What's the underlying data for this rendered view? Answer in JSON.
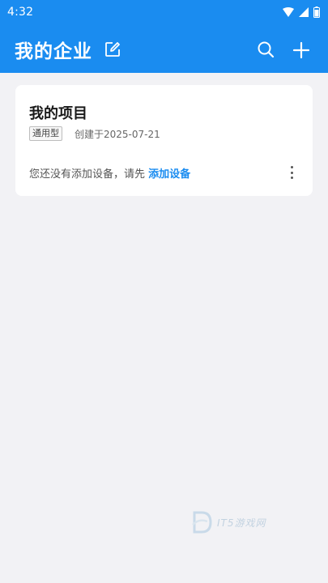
{
  "status_bar": {
    "time": "4:32"
  },
  "appbar": {
    "title": "我的企业"
  },
  "project": {
    "name": "我的项目",
    "type_tag": "通用型",
    "created": "创建于2025-07-21",
    "empty_text": "您还没有添加设备，请先",
    "add_device_link": "添加设备"
  },
  "watermark": {
    "text": "IT5游戏网"
  },
  "colors": {
    "primary": "#1a8cf0",
    "background": "#f2f2f5"
  }
}
